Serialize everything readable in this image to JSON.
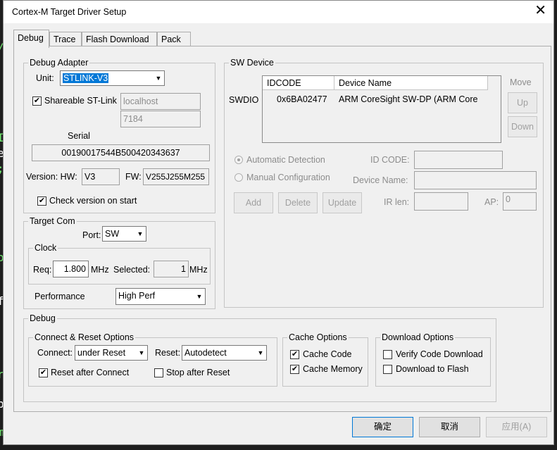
{
  "background_glyphs": [
    {
      "text": "/",
      "color": "#6ee16e"
    },
    {
      "text": "I",
      "color": "#6ee16e"
    },
    {
      "text": "e",
      "color": "#ffffff"
    },
    {
      "text": ";",
      "color": "#6ee16e"
    },
    {
      "text": "o",
      "color": "#6ee16e"
    },
    {
      "text": "f",
      "color": "#ffffff"
    },
    {
      "text": "r",
      "color": "#6ee16e"
    },
    {
      "text": "p",
      "color": "#ffffff"
    },
    {
      "text": "m",
      "color": "#6ee16e"
    }
  ],
  "window": {
    "title": "Cortex-M Target Driver Setup",
    "close_glyph": "✕"
  },
  "tabs": [
    "Debug",
    "Trace",
    "Flash Download",
    "Pack"
  ],
  "active_tab": "Debug",
  "debug_adapter": {
    "legend": "Debug Adapter",
    "unit_label": "Unit:",
    "unit_value": "STLINK-V3",
    "shareable_label": "Shareable ST-Link",
    "shareable_checked": true,
    "host": "localhost",
    "port": "7184",
    "serial_label": "Serial",
    "serial_value": "00190017544B500420343637",
    "version_label": "Version: HW:",
    "hw_value": "V3",
    "fw_label": "FW:",
    "fw_value": "V255J255M255",
    "check_version_label": "Check version on start",
    "check_version_checked": true
  },
  "sw_device": {
    "legend": "SW Device",
    "columns": [
      "IDCODE",
      "Device Name"
    ],
    "row_label": "SWDIO",
    "rows": [
      {
        "idcode": "0x6BA02477",
        "device_name": "ARM CoreSight SW-DP (ARM Core"
      }
    ],
    "move_label": "Move",
    "up_label": "Up",
    "down_label": "Down",
    "auto_detect_label": "Automatic Detection",
    "manual_config_label": "Manual Configuration",
    "id_code_label": "ID CODE:",
    "device_name_label": "Device Name:",
    "add_label": "Add",
    "delete_label": "Delete",
    "update_label": "Update",
    "ir_len_label": "IR len:",
    "ap_label": "AP:",
    "ap_value": "0"
  },
  "target_com": {
    "legend": "Target Com",
    "port_label": "Port:",
    "port_value": "SW",
    "clock_legend": "Clock",
    "req_label": "Req:",
    "req_value": "1.800",
    "req_unit": "MHz",
    "selected_label": "Selected:",
    "selected_value": "1",
    "selected_unit": "MHz",
    "performance_label": "Performance",
    "performance_value": "High Perf"
  },
  "debug_section": {
    "legend": "Debug",
    "connect_reset": {
      "legend": "Connect & Reset Options",
      "connect_label": "Connect:",
      "connect_value": "under Reset",
      "reset_label": "Reset:",
      "reset_value": "Autodetect",
      "reset_after_connect_label": "Reset after Connect",
      "reset_after_connect_checked": true,
      "stop_after_reset_label": "Stop after Reset",
      "stop_after_reset_checked": false
    },
    "cache": {
      "legend": "Cache Options",
      "cache_code_label": "Cache Code",
      "cache_code_checked": true,
      "cache_memory_label": "Cache Memory",
      "cache_memory_checked": true
    },
    "download": {
      "legend": "Download Options",
      "verify_label": "Verify Code Download",
      "verify_checked": false,
      "download_flash_label": "Download to Flash",
      "download_flash_checked": false
    }
  },
  "footer": {
    "ok_label": "确定",
    "cancel_label": "取消",
    "apply_label": "应用(A)"
  }
}
